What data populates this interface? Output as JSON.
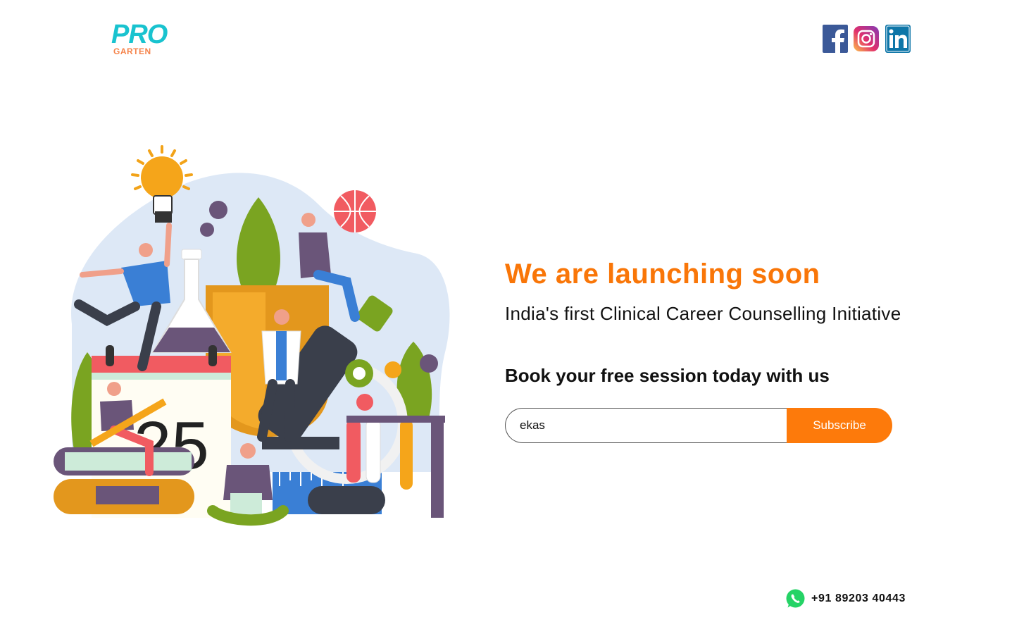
{
  "brand": {
    "logo_top": "PRO",
    "logo_bottom": "GARTEN"
  },
  "social": [
    {
      "name": "facebook",
      "icon": "facebook-icon",
      "color": "#3b5998"
    },
    {
      "name": "instagram",
      "icon": "instagram-icon",
      "color": "#e1306c"
    },
    {
      "name": "linkedin",
      "icon": "linkedin-icon",
      "color": "#0e76a8"
    }
  ],
  "hero": {
    "headline": "We are launching soon",
    "tagline": "India's first Clinical Career Counselling Initiative",
    "cta_heading": "Book your free session today with us",
    "illustration_calendar_number": "25"
  },
  "subscribe": {
    "input_value": "ekas",
    "button_label": "Subscribe",
    "accent": "#fd7a0b"
  },
  "contact": {
    "icon": "whatsapp-icon",
    "phone": "+91 89203 40443",
    "icon_color": "#25d366"
  }
}
